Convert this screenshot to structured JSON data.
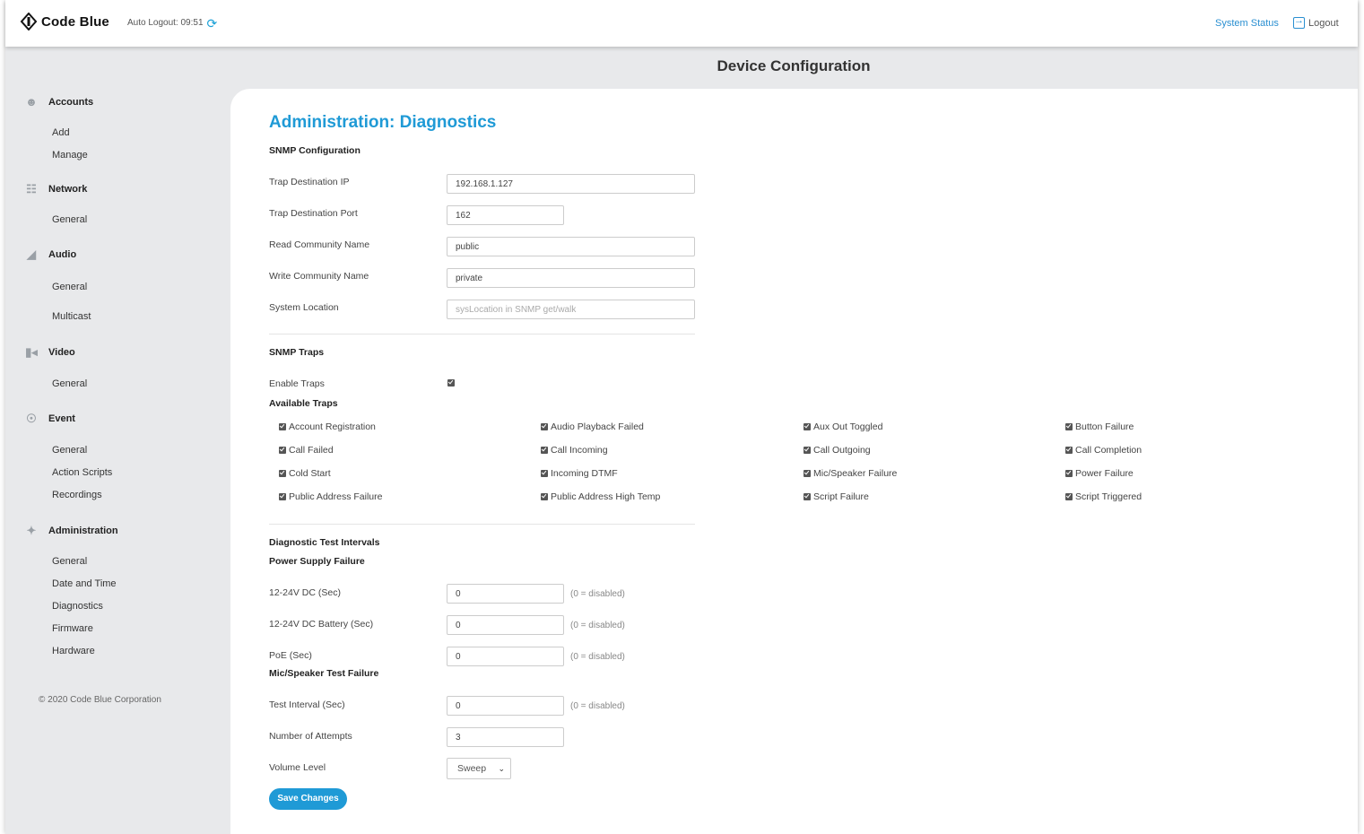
{
  "header": {
    "brand": "Code Blue",
    "auto_logout": "Auto Logout: 09:51",
    "system_status": "System Status",
    "logout": "Logout"
  },
  "page_title": "Device Configuration",
  "sidebar": {
    "sections": [
      {
        "label": "Accounts",
        "icon": "users-icon",
        "items": [
          "Add",
          "Manage"
        ]
      },
      {
        "label": "Network",
        "icon": "network-icon",
        "items": [
          "General"
        ]
      },
      {
        "label": "Audio",
        "icon": "speaker-icon",
        "items": [
          "General",
          "Multicast"
        ]
      },
      {
        "label": "Video",
        "icon": "camera-icon",
        "items": [
          "General"
        ]
      },
      {
        "label": "Event",
        "icon": "event-icon",
        "items": [
          "General",
          "Action Scripts",
          "Recordings"
        ]
      },
      {
        "label": "Administration",
        "icon": "wrench-icon",
        "items": [
          "General",
          "Date and Time",
          "Diagnostics",
          "Firmware",
          "Hardware"
        ]
      }
    ],
    "copyright": "© 2020 Code Blue Corporation"
  },
  "main": {
    "heading": "Administration: Diagnostics",
    "snmp_config": {
      "title": "SNMP Configuration",
      "fields": [
        {
          "label": "Trap Destination IP",
          "value": "192.168.1.127",
          "placeholder": ""
        },
        {
          "label": "Trap Destination Port",
          "value": "162",
          "placeholder": ""
        },
        {
          "label": "Read Community Name",
          "value": "public",
          "placeholder": ""
        },
        {
          "label": "Write Community Name",
          "value": "private",
          "placeholder": ""
        },
        {
          "label": "System Location",
          "value": "",
          "placeholder": "sysLocation in SNMP get/walk"
        }
      ]
    },
    "snmp_traps": {
      "title": "SNMP Traps",
      "enable_label": "Enable Traps",
      "enable_checked": true,
      "available_title": "Available Traps",
      "traps": [
        "Account Registration",
        "Audio Playback Failed",
        "Aux Out Toggled",
        "Button Failure",
        "Call Failed",
        "Call Incoming",
        "Call Outgoing",
        "Call Completion",
        "Cold Start",
        "Incoming DTMF",
        "Mic/Speaker Failure",
        "Power Failure",
        "Public Address Failure",
        "Public Address High Temp",
        "Script Failure",
        "Script Triggered"
      ]
    },
    "diagnostics": {
      "title": "Diagnostic Test Intervals",
      "power_title": "Power Supply Failure",
      "power_fields": [
        {
          "label": "12-24V DC (Sec)",
          "value": "0",
          "hint": "(0 = disabled)"
        },
        {
          "label": "12-24V DC Battery (Sec)",
          "value": "0",
          "hint": "(0 = disabled)"
        },
        {
          "label": "PoE (Sec)",
          "value": "0",
          "hint": "(0 = disabled)"
        }
      ],
      "mic_title": "Mic/Speaker Test Failure",
      "mic_fields": [
        {
          "label": "Test Interval (Sec)",
          "value": "0",
          "hint": "(0 = disabled)"
        },
        {
          "label": "Number of Attempts",
          "value": "3",
          "hint": ""
        }
      ],
      "volume_label": "Volume Level",
      "volume_value": "Sweep"
    },
    "save_label": "Save Changes"
  },
  "colors": {
    "accent": "#1f9ad6",
    "link": "#2a8fd1",
    "background": "#e8e9eb"
  }
}
